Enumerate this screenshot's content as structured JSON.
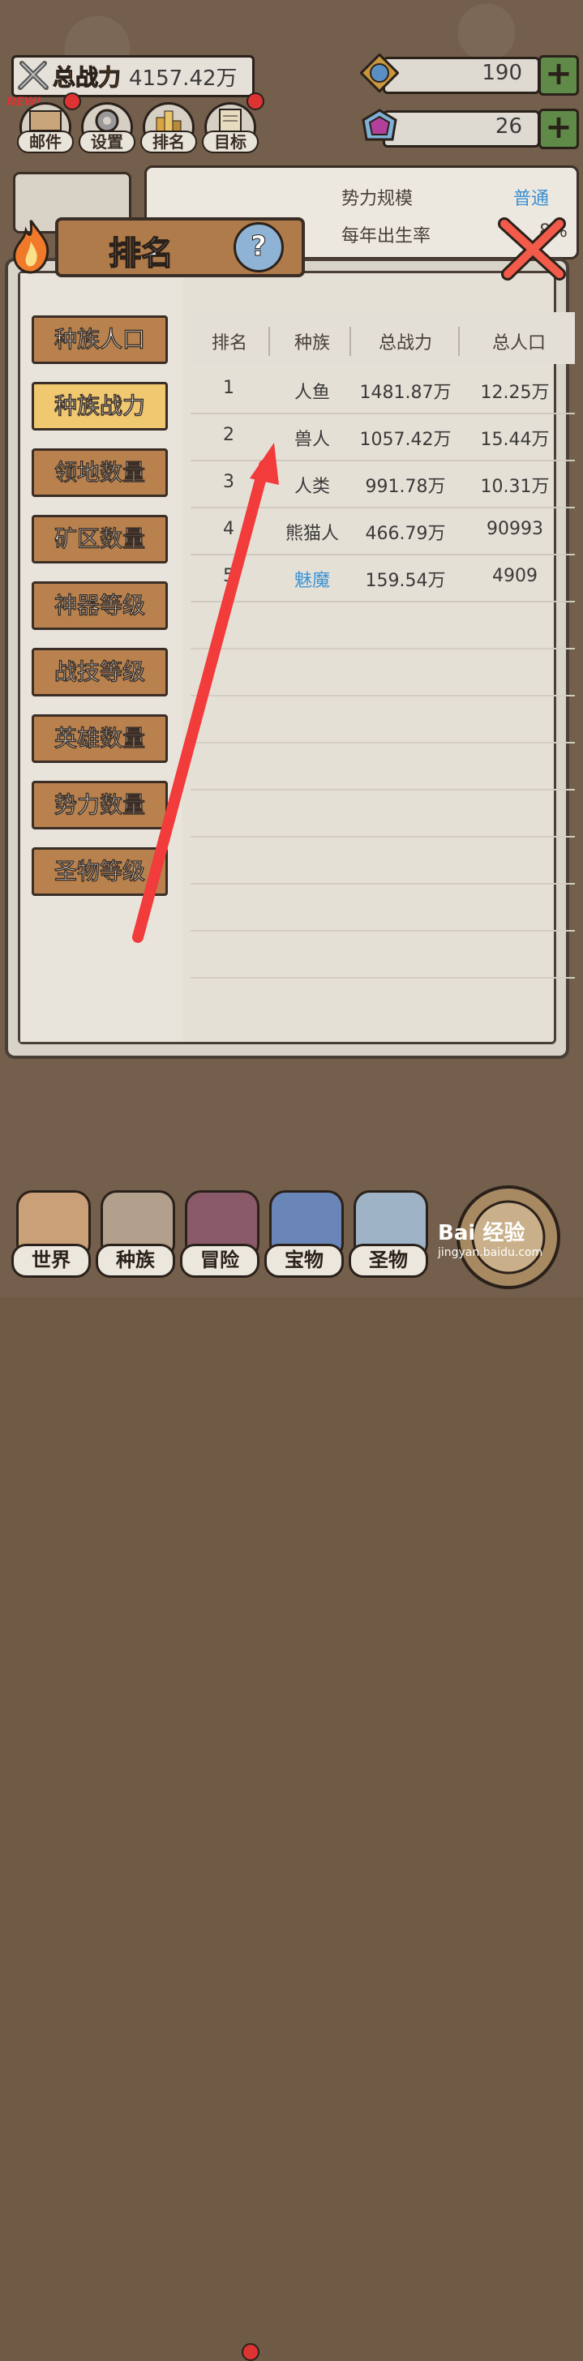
{
  "top": {
    "power_label": "总战力",
    "power_value": "4157.42万",
    "currency1": "190",
    "currency2": "26",
    "new_badge": "NEW!",
    "buttons": [
      "邮件",
      "设置",
      "排名",
      "目标"
    ]
  },
  "info": {
    "row1_label": "势力规模",
    "row1_value": "普通",
    "row2_label": "每年出生率",
    "row2_value": "8%"
  },
  "panel": {
    "title": "排名",
    "help": "?",
    "tabs": [
      "种族人口",
      "种族战力",
      "领地数量",
      "矿区数量",
      "神器等级",
      "战技等级",
      "英雄数量",
      "势力数量",
      "圣物等级"
    ],
    "active_tab": "种族战力",
    "columns": [
      "排名",
      "种族",
      "总战力",
      "总人口"
    ],
    "rows": [
      {
        "rank": "1",
        "race": "人鱼",
        "power": "1481.87万",
        "population": "12.25万"
      },
      {
        "rank": "2",
        "race": "兽人",
        "power": "1057.42万",
        "population": "15.44万"
      },
      {
        "rank": "3",
        "race": "人类",
        "power": "991.78万",
        "population": "10.31万"
      },
      {
        "rank": "4",
        "race": "熊猫人",
        "power": "466.79万",
        "population": "90993"
      },
      {
        "rank": "5",
        "race": "魅魔",
        "power": "159.54万",
        "population": "4909"
      }
    ]
  },
  "nav": [
    "世界",
    "种族",
    "冒险",
    "宝物",
    "圣物"
  ],
  "watermark": {
    "main": "Bai 经验",
    "sub": "jingyan.baidu.com"
  },
  "colors": {
    "accent_blue": "#3b95d8",
    "tab_wood": "#b8814d",
    "tab_active": "#f0c870",
    "plus_green": "#5f8a47",
    "arrow_red": "#f23b3b"
  }
}
